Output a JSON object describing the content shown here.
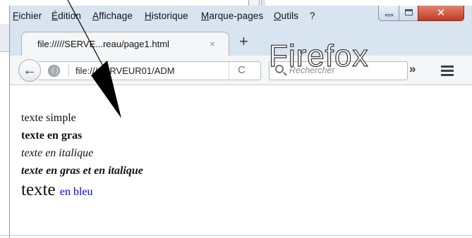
{
  "menubar": {
    "items": [
      "Fichier",
      "Édition",
      "Affichage",
      "Historique",
      "Marque-pages",
      "Outils",
      "?"
    ]
  },
  "tab": {
    "title": "file://///SERVE...reau/page1.html",
    "close": "×",
    "new_tab": "+"
  },
  "navbar": {
    "back": "←",
    "url": "file:///SERVEUR01/ADM",
    "reload": "C",
    "search_placeholder": "Rechercher",
    "overflow": "»"
  },
  "overlay": {
    "text": "Firefox"
  },
  "page": {
    "line1": "texte simple",
    "line2": "texte en gras",
    "line3": "texte en italique",
    "line4": "texte en gras et en italique",
    "line5_big": "texte",
    "line5_blue": "en bleu"
  },
  "icons": {
    "back": "arrow-left",
    "site": "globe",
    "reload": "reload",
    "search": "magnifier",
    "menu": "hamburger",
    "window_minimize": "minimize",
    "window_maximize": "maximize",
    "window_close": "close"
  },
  "colors": {
    "chrome_blue": "#d9e4f1",
    "close_red": "#c33a22",
    "link_blue": "#0000ff"
  }
}
